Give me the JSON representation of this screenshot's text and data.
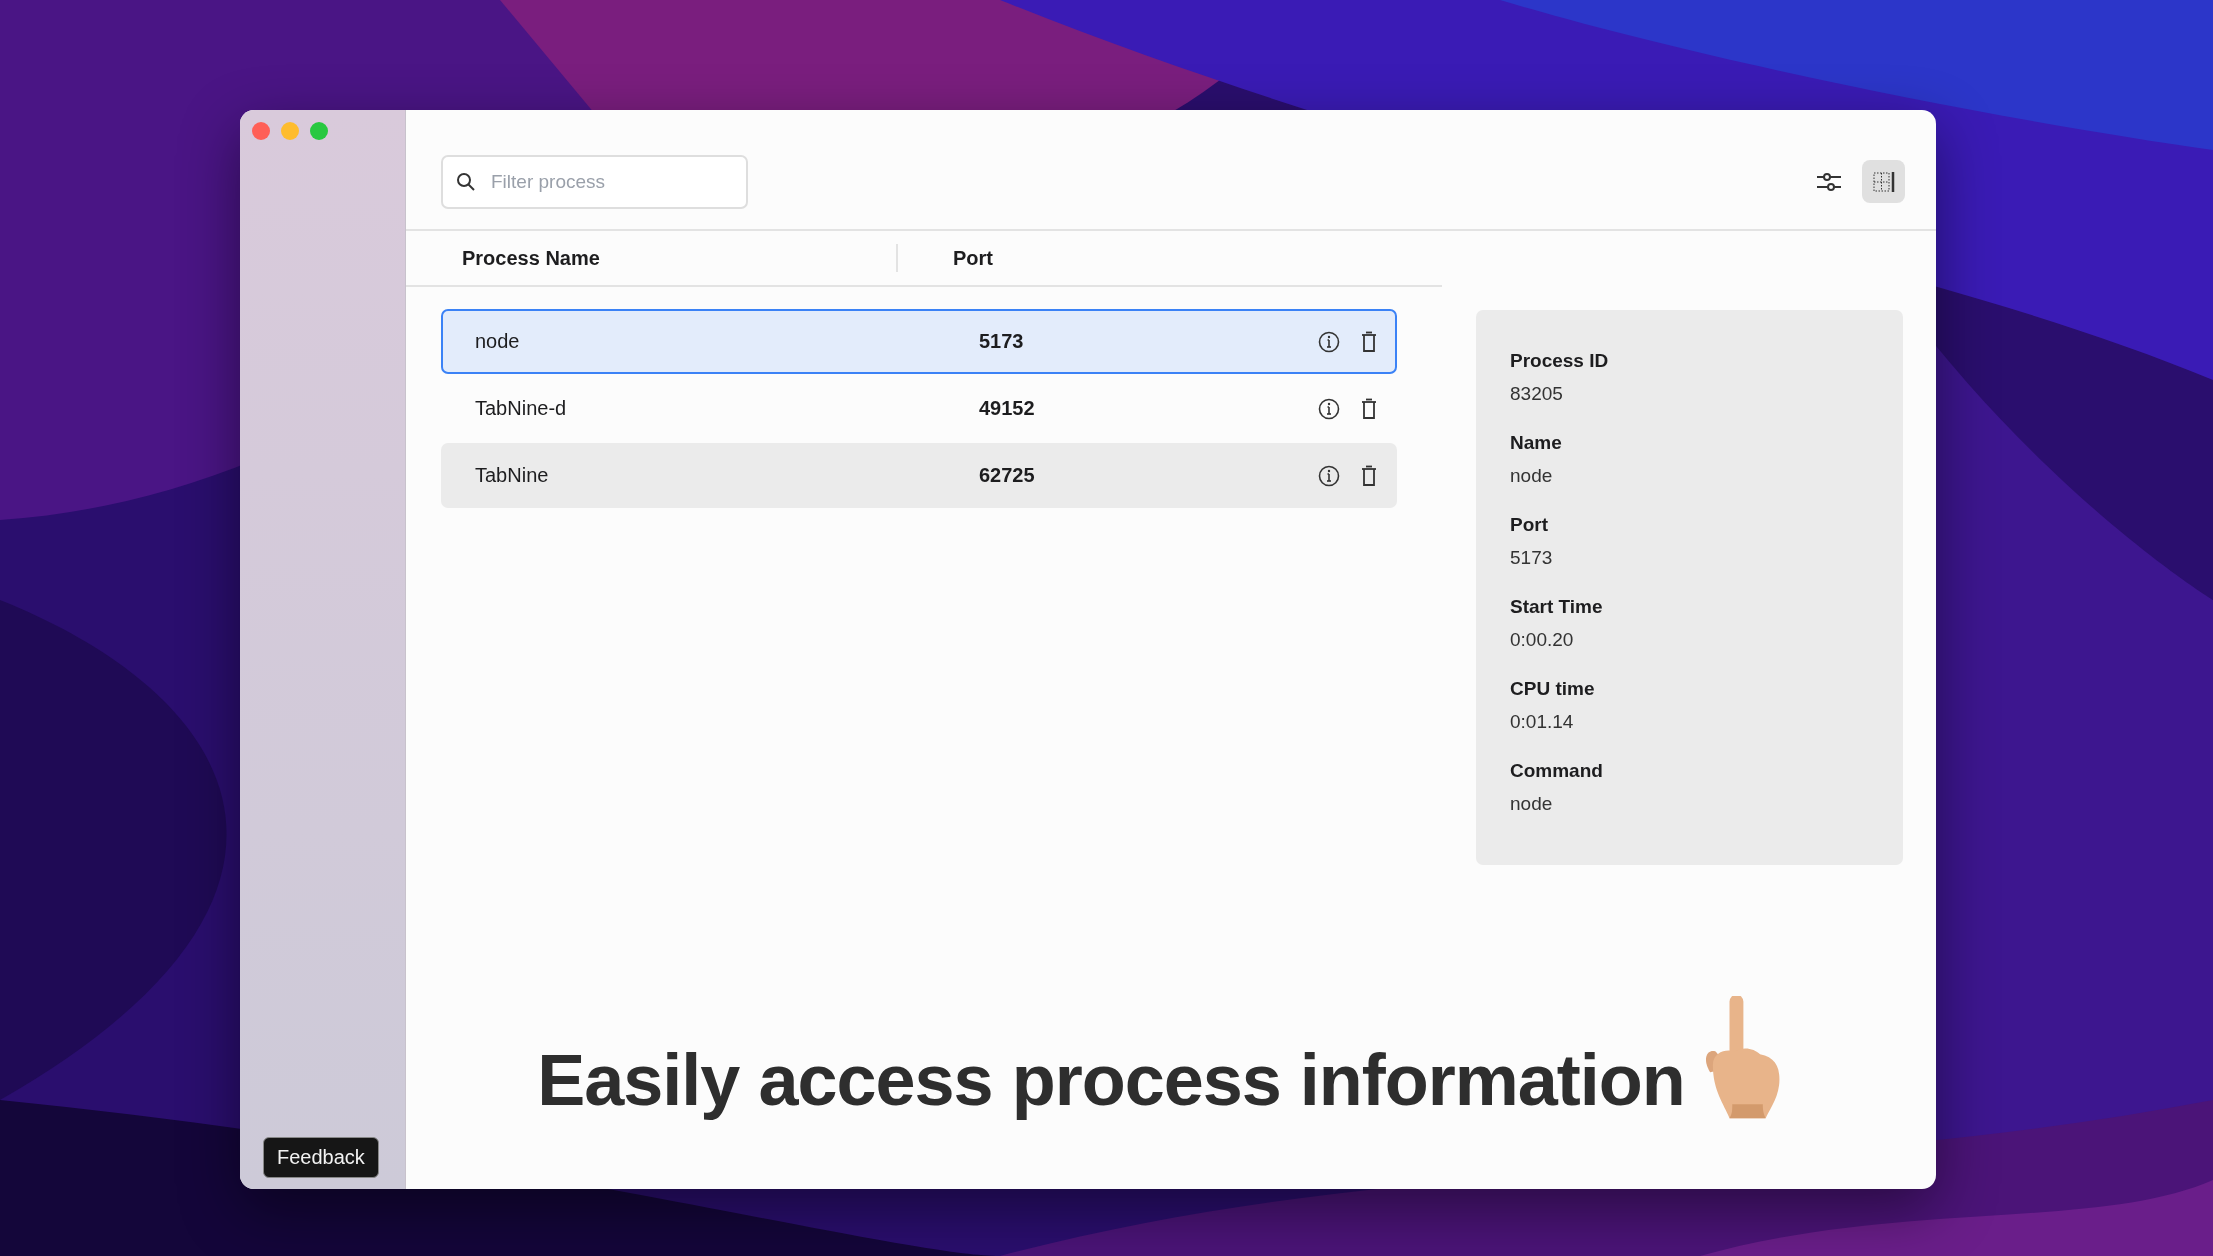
{
  "sidebar": {
    "feedback_button": "Feedback"
  },
  "toolbar": {
    "search": {
      "placeholder": "Filter process"
    },
    "buttons": [
      {
        "kind": "filters",
        "selected": false
      },
      {
        "kind": "layout",
        "selected": true
      }
    ]
  },
  "table": {
    "columns": [
      "Process Name",
      "Port"
    ],
    "rows": [
      {
        "name": "node",
        "port": "5173",
        "selected": true,
        "hovered": false
      },
      {
        "name": "TabNine-d",
        "port": "49152",
        "selected": false,
        "hovered": false
      },
      {
        "name": "TabNine",
        "port": "62725",
        "selected": false,
        "hovered": true
      }
    ]
  },
  "details": [
    {
      "label": "Process ID",
      "value": "83205"
    },
    {
      "label": "Name",
      "value": "node"
    },
    {
      "label": "Port",
      "value": "5173"
    },
    {
      "label": "Start Time",
      "value": "0:00.20"
    },
    {
      "label": "CPU time",
      "value": "0:01.14"
    },
    {
      "label": "Command",
      "value": "node"
    }
  ],
  "caption": "Easily access process information"
}
